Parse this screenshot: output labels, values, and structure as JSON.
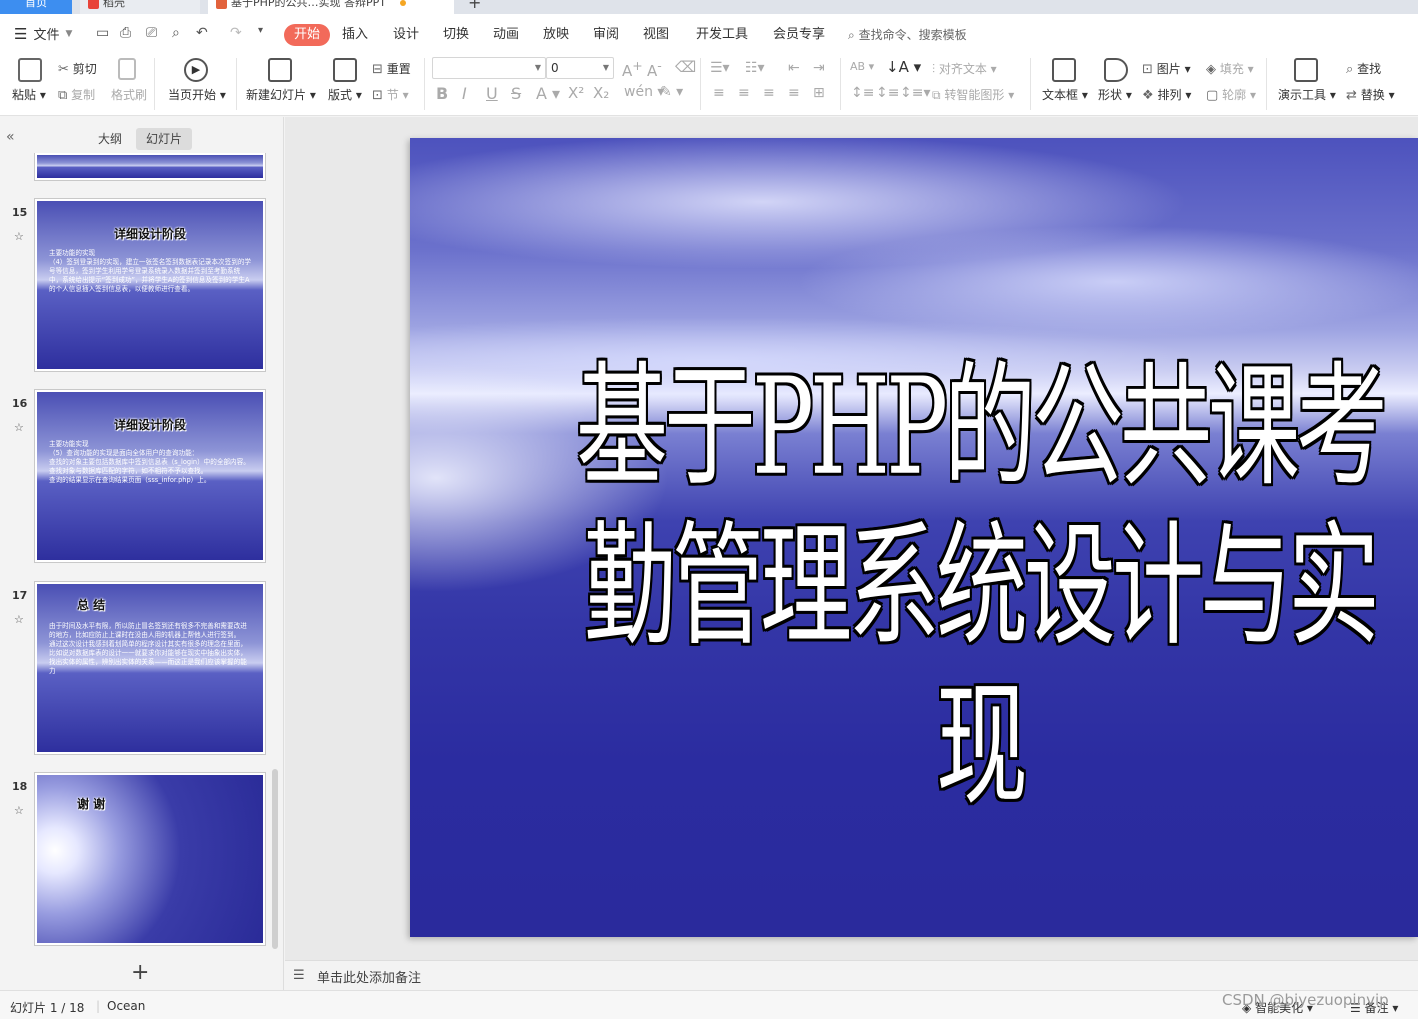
{
  "tabs": {
    "home": "首页",
    "dao": "稻壳",
    "file": "基于PHP的公共…实现 答辩PPT",
    "plus": "+"
  },
  "menu": {
    "file": "文件",
    "tabs": [
      "开始",
      "插入",
      "设计",
      "切换",
      "动画",
      "放映",
      "审阅",
      "视图",
      "开发工具",
      "会员专享"
    ],
    "search": "查找命令、搜索模板"
  },
  "ribbon": {
    "paste": "粘贴",
    "cut": "剪切",
    "copy": "复制",
    "format_painter": "格式刷",
    "from_start": "当页开始",
    "new_slide": "新建幻灯片",
    "layout": "版式",
    "reset": "重置",
    "section": "节",
    "font_size": "0",
    "align_text": "对齐文本",
    "smart_art": "转智能图形",
    "textbox": "文本框",
    "shape": "形状",
    "picture": "图片",
    "fill": "填充",
    "arrange": "排列",
    "outline": "轮廓",
    "present_tools": "演示工具",
    "find": "查找",
    "replace": "替换"
  },
  "left_panel": {
    "tab_outline": "大纲",
    "tab_slides": "幻灯片",
    "thumbs": [
      {
        "num": "15",
        "title": "详细设计阶段",
        "body": "主要功能的实现\n（4）签到登录到的实现，建立一张签名签到数据表记录本次签到的学号等信息，签到学生利用学号登录系统录入数据并签到至考勤系统中，系统给出提示“签到成功”，并将学生A的签到信息及签到的学生A的个人信息插入签到信息表，以便教师进行查看。"
      },
      {
        "num": "16",
        "title": "详细设计阶段",
        "body": "主要功能实现\n（5）查询功能的实现是面向全体用户的查询功能：\n查找的对象主要包括数据库中签到信息表（s_login）中的全部内容。\n查找对象与数据库匹配的字符，如不相符不予以查找。\n查询的结果显示在查询结果页面（sss_infor.php）上。"
      },
      {
        "num": "17",
        "title": "总 结",
        "body": "由于时间及水平有限，所以防止冒名签到还有很多不完善和需要改进的地方，比如应防止上课时在没由人用的机器上帮他人进行签到。\n通过这次设计我感到着划简单的程序设计其实有很多的理念在里面，比如说对数据库表的设计一一就要求你对能够在现实中抽象出实体，找出实体的属性，辨别出实体的关系——而这正是我们应该掌握的能力"
      },
      {
        "num": "18",
        "title": "谢 谢",
        "body": ""
      }
    ],
    "add_label": "+"
  },
  "slide": {
    "title": "基于PHP的公共课考勤管理系统设计与实现"
  },
  "notes": {
    "placeholder": "单击此处添加备注"
  },
  "status": {
    "slide_indicator": "幻灯片 1 / 18",
    "theme": "Ocean",
    "smart_beautify": "智能美化",
    "notes_toggle": "备注",
    "watermark": "CSDN @biyezuopinvip"
  },
  "colors": {
    "accent": "#f26a5a",
    "home_tab": "#3d8ef0",
    "slide_dark": "#2a2a9c"
  }
}
